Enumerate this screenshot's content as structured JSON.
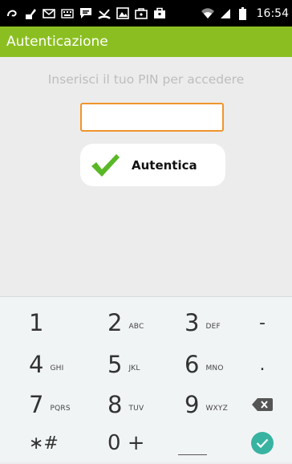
{
  "status_bar": {
    "time": "16:54",
    "icons": [
      "swirl-icon",
      "paint-icon",
      "mail-icon",
      "keyboard-icon",
      "message-icon",
      "missed-call-icon",
      "gallery-icon",
      "bag-icon",
      "briefcase-icon"
    ],
    "right_icons": [
      "wifi-icon",
      "signal-icon",
      "battery-icon"
    ]
  },
  "app_bar": {
    "title": "Autenticazione"
  },
  "content": {
    "prompt": "Inserisci il tuo PIN per accedere",
    "pin_value": "",
    "auth_button": "Autentica"
  },
  "colors": {
    "accent": "#8bbf21",
    "input_border": "#f0952b",
    "check_green": "#58b825",
    "done_teal": "#38b3a1"
  },
  "keyboard": {
    "rows": [
      [
        {
          "digit": "1",
          "letters": ""
        },
        {
          "digit": "2",
          "letters": "ABC"
        },
        {
          "digit": "3",
          "letters": "DEF"
        },
        {
          "symbol": "-"
        }
      ],
      [
        {
          "digit": "4",
          "letters": "GHI"
        },
        {
          "digit": "5",
          "letters": "JKL"
        },
        {
          "digit": "6",
          "letters": "MNO"
        },
        {
          "symbol": "."
        }
      ],
      [
        {
          "digit": "7",
          "letters": "PQRS"
        },
        {
          "digit": "8",
          "letters": "TUV"
        },
        {
          "digit": "9",
          "letters": "WXYZ"
        },
        {
          "icon": "backspace-icon"
        }
      ],
      [
        {
          "symbol": "∗#"
        },
        {
          "symbol": "0 +"
        },
        {
          "icon": "space-icon"
        },
        {
          "icon": "done-check-icon"
        }
      ]
    ]
  }
}
